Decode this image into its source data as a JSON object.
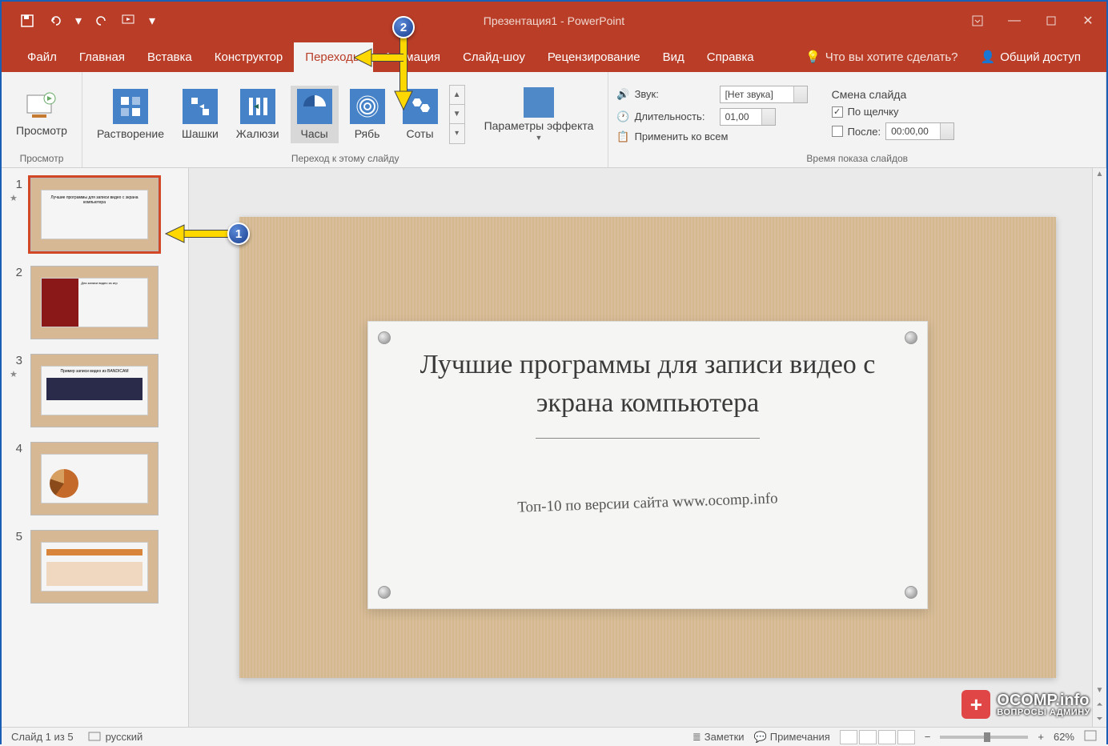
{
  "title": "Презентация1  -  PowerPoint",
  "tabs": {
    "file": "Файл",
    "home": "Главная",
    "insert": "Вставка",
    "design": "Конструктор",
    "transitions": "Переходы",
    "animations": "Анимация",
    "slideshow": "Слайд-шоу",
    "review": "Рецензирование",
    "view": "Вид",
    "help": "Справка"
  },
  "tellme": "Что вы хотите сделать?",
  "share": "Общий доступ",
  "ribbon": {
    "preview_group": "Просмотр",
    "preview_btn": "Просмотр",
    "transition_group": "Переход к этому слайду",
    "effects": {
      "dissolve": "Растворение",
      "checker": "Шашки",
      "blinds": "Жалюзи",
      "clock": "Часы",
      "ripple": "Рябь",
      "honeycomb": "Соты"
    },
    "effect_options": "Параметры эффекта",
    "timing_group": "Время показа слайдов",
    "sound_label": "Звук:",
    "sound_value": "[Нет звука]",
    "duration_label": "Длительность:",
    "duration_value": "01,00",
    "apply_all": "Применить ко всем",
    "advance_title": "Смена слайда",
    "on_click": "По щелчку",
    "after_label": "После:",
    "after_value": "00:00,00"
  },
  "slide": {
    "title": "Лучшие программы для записи видео с экрана компьютера",
    "subtitle": "Топ-10 по версии сайта www.ocomp.info"
  },
  "thumbs": {
    "t1": "Лучшие программы для записи видео с экрана компьютера",
    "t2": "Для записи видео из игр",
    "t3": "Пример записи видео из BANDICAM",
    "t4": "Диаграмма",
    "t5": "Таблица"
  },
  "status": {
    "slide_of": "Слайд 1 из 5",
    "lang": "русский",
    "notes": "Заметки",
    "comments": "Примечания",
    "zoom": "62%"
  },
  "callouts": {
    "one": "1",
    "two": "2"
  },
  "watermark": {
    "line1": "OCOMP.info",
    "line2": "ВОПРОСЫ АДМИНУ"
  }
}
